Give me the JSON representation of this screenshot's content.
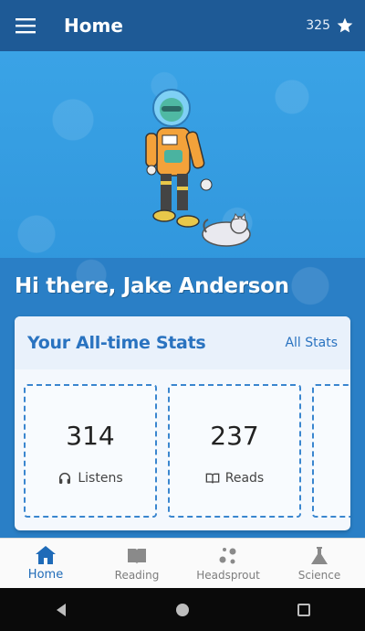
{
  "appbar": {
    "title": "Home",
    "points": "325",
    "menu_icon": "hamburger-menu-icon",
    "star_icon": "star-icon"
  },
  "hero": {
    "greeting": "Hi there, Jake Anderson"
  },
  "stats": {
    "title": "Your All-time Stats",
    "all_stats_link": "All Stats",
    "tiles": [
      {
        "value": "314",
        "label": "Listens",
        "icon": "headphones-icon"
      },
      {
        "value": "237",
        "label": "Reads",
        "icon": "open-book-icon"
      }
    ]
  },
  "bottom_nav": {
    "items": [
      {
        "label": "Home",
        "icon": "home-icon",
        "active": true
      },
      {
        "label": "Reading",
        "icon": "book-icon",
        "active": false
      },
      {
        "label": "Headsprout",
        "icon": "headsprout-icon",
        "active": false
      },
      {
        "label": "Science",
        "icon": "flask-icon",
        "active": false
      }
    ]
  },
  "colors": {
    "appbar": "#1e5a96",
    "accent": "#2a73c0",
    "hero": "#3aa3e6"
  }
}
